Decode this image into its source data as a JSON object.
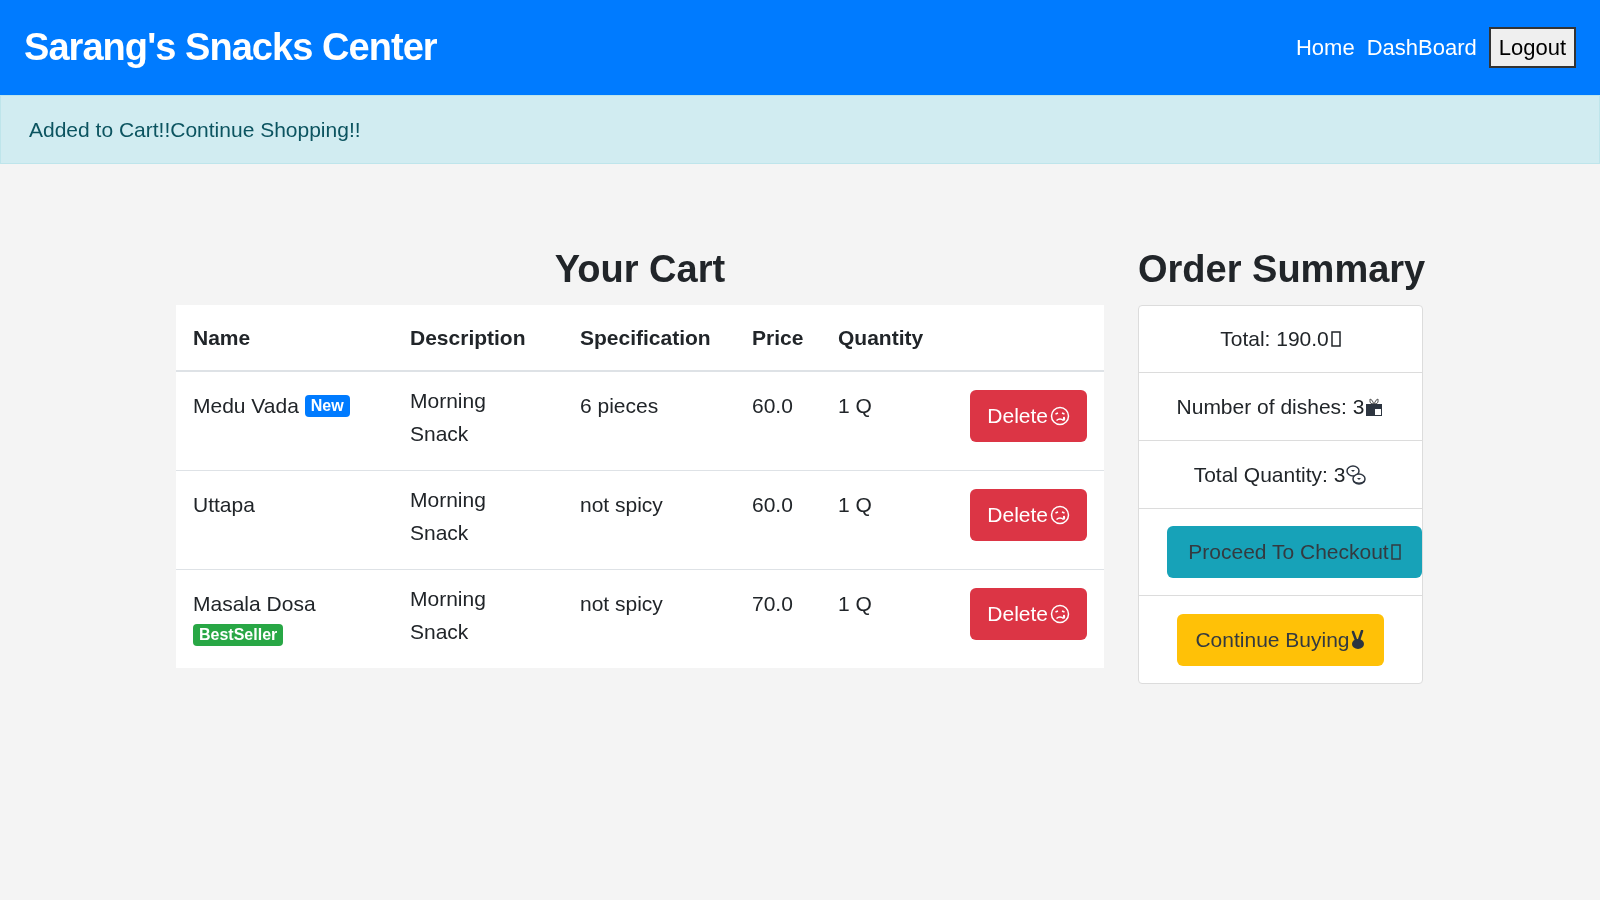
{
  "navbar": {
    "brand": "Sarang's Snacks Center",
    "links": [
      "Home",
      "DashBoard"
    ],
    "logout": "Logout"
  },
  "alert": {
    "message": "Added to Cart!!Continue Shopping!!"
  },
  "cart": {
    "title": "Your Cart",
    "columns": [
      "Name",
      "Description",
      "Specification",
      "Price",
      "Quantity"
    ],
    "rows": [
      {
        "name": "Medu Vada",
        "badge": {
          "text": "New",
          "color": "#007bff"
        },
        "description": "Morning Snack",
        "specification": "6 pieces",
        "price": "60.0",
        "quantity": "1 Q",
        "action": "Delete"
      },
      {
        "name": "Uttapa",
        "description": "Morning Snack",
        "specification": "not spicy",
        "price": "60.0",
        "quantity": "1 Q",
        "action": "Delete"
      },
      {
        "name": "Masala Dosa",
        "badge": {
          "text": "BestSeller",
          "color": "#28a745"
        },
        "description": "Morning Snack",
        "specification": "not spicy",
        "price": "70.0",
        "quantity": "1 Q",
        "action": "Delete"
      }
    ]
  },
  "summary": {
    "title": "Order Summary",
    "total": "Total: 190.0",
    "dishes": "Number of dishes: 3",
    "quantity": "Total Quantity: 3",
    "checkout": "Proceed To Checkout",
    "continue": "Continue Buying"
  }
}
